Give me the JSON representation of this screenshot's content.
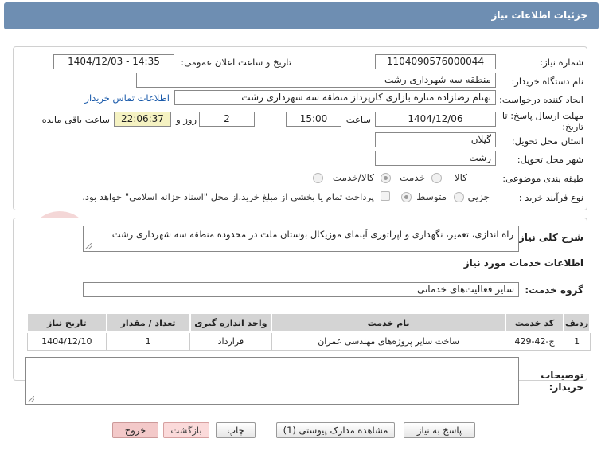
{
  "header": {
    "title": "جزئیات اطلاعات نیاز"
  },
  "form": {
    "need_number_label": "شماره نیاز:",
    "need_number": "1104090576000044",
    "announce_label": "تاریخ و ساعت اعلان عمومی:",
    "announce_value": "1404/12/03 - 14:35",
    "buyer_org_label": "نام دستگاه خریدار:",
    "buyer_org": "منطقه سه شهرداری رشت",
    "creator_label": "ایجاد کننده درخواست:",
    "creator": "بهنام رضازاده مناره بازاری کارپرداز  منطقه سه شهرداری رشت",
    "contact_link": "اطلاعات تماس خریدار",
    "deadline_label_1": "مهلت ارسال پاسخ: تا",
    "deadline_label_2": "تاریخ:",
    "deadline_date": "1404/12/06",
    "time_label": "ساعت",
    "deadline_time": "15:00",
    "days_value": "2",
    "days_label": "روز و",
    "remaining_time": "22:06:37",
    "remaining_label": "ساعت باقی مانده",
    "province_label": "استان محل تحویل:",
    "province": "گیلان",
    "city_label": "شهر محل تحویل:",
    "city": "رشت",
    "category_label": "طبقه بندی موضوعی:",
    "category_options": [
      "کالا",
      "خدمت",
      "کالا/خدمت"
    ],
    "process_label": "نوع فرآیند خرید :",
    "process_options": [
      "جزیی",
      "متوسط"
    ],
    "payment_note": "پرداخت تمام یا بخشی از مبلغ خرید،از محل \"اسناد خزانه اسلامی\" خواهد بود."
  },
  "description": {
    "label": "شرح کلی نیاز:",
    "text": "راه اندازی، تعمیر، نگهداری و اپراتوری آبنمای موزیکال بوستان ملت در محدوده منطقه سه شهرداری رشت"
  },
  "services": {
    "section_title": "اطلاعات خدمات مورد نیاز",
    "group_label": "گروه خدمت:",
    "group_value": "سایر فعالیت‌های خدماتی",
    "columns": [
      "ردیف",
      "کد خدمت",
      "نام خدمت",
      "واحد اندازه گیری",
      "تعداد / مقدار",
      "تاریخ نیاز"
    ],
    "rows": [
      [
        "1",
        "ج-42-429",
        "ساخت سایر پروژه‌های مهندسی عمران",
        "قرارداد",
        "1",
        "1404/12/10"
      ]
    ]
  },
  "buyer_notes": {
    "label_1": "توضیحات",
    "label_2": "خریدار:",
    "text": ""
  },
  "buttons": {
    "reply": "پاسخ به نیاز",
    "view_docs": "مشاهده مدارک پیوستی (1)",
    "print": "چاپ",
    "back": "بازگشت",
    "exit": "خروج"
  },
  "watermark": {
    "text": "AriaTender.net"
  },
  "colors": {
    "header_bg": "#6e8eb2",
    "table_header_bg": "#d4d4d4",
    "link": "#1a5aaa",
    "remaining_bg": "#f5f2c2"
  }
}
